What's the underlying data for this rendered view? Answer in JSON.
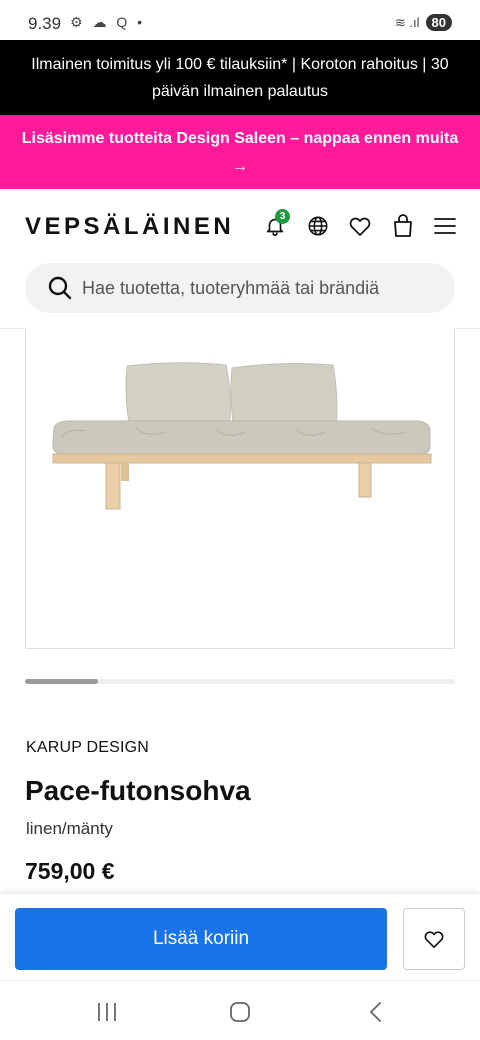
{
  "status_bar": {
    "time": "9.39",
    "left_icons": "⚙ ☁ Q •",
    "signal": "≋ .ıl",
    "battery": "80"
  },
  "promo": {
    "shipping_text": "Ilmainen toimitus yli 100 € tilauksiin* | Koroton rahoitus | 30 päivän ilmainen palautus",
    "sale_text": "Lisäsimme tuotteita Design Saleen – nappaa ennen muita",
    "sale_arrow": "→"
  },
  "header": {
    "logo": "VEPSÄLÄINEN",
    "notification_count": "3",
    "icons": [
      "bell-icon",
      "globe-icon",
      "heart-icon",
      "bag-icon",
      "menu-icon"
    ]
  },
  "search": {
    "placeholder": "Hae tuotetta, tuoteryhmää tai brändiä"
  },
  "gallery": {
    "scroll_position": 0.17
  },
  "product": {
    "brand": "KARUP DESIGN",
    "name": "Pace-futonsohva",
    "variant": "linen/mänty",
    "price": "759,00 €"
  },
  "actions": {
    "add_to_cart": "Lisää koriin"
  },
  "colors": {
    "promo_pink": "#ff1a9a",
    "cta_blue": "#1a73e8",
    "badge_green": "#1f9a3e"
  }
}
